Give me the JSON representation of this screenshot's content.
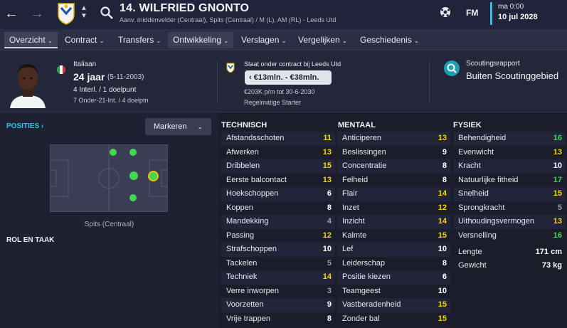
{
  "header": {
    "name": "14. WILFRIED GNONTO",
    "subtitle": "Aanv. middenvelder (Centraal), Spits (Centraal) / M (L), AM (RL) - Leeds Utd",
    "fm_label": "FM",
    "time": "ma 0:00",
    "date": "10 jul 2028"
  },
  "nav": [
    "Overzicht",
    "Contract",
    "Transfers",
    "Ontwikkeling",
    "Verslagen",
    "Vergelijken",
    "Geschiedenis"
  ],
  "info": {
    "nationality": "Italiaan",
    "age": "24 jaar",
    "dob": "(5-11-2003)",
    "caps": "4 Interl. / 1 doelpunt",
    "u21": "7 Onder-21-Int. / 4 doelptn",
    "contract_status": "Staat onder contract bij Leeds Utd",
    "value_range": "€13mln. - €38mln.",
    "wage": "€203K p/m tot 30-6-2030",
    "squad_status": "Regelmatige Starter",
    "scouting_title": "Scoutingsrapport",
    "scouting_value": "Buiten Scoutinggebied"
  },
  "left": {
    "positions_label": "POSITIES",
    "dropdown": "Markeren",
    "position_caption": "Spits (Centraal)",
    "role_label": "ROL EN TAAK"
  },
  "technical": {
    "header": "TECHNISCH",
    "rows": [
      {
        "name": "Afstandsschoten",
        "value": "11",
        "color": "#f5d800"
      },
      {
        "name": "Afwerken",
        "value": "13",
        "color": "#f5d800"
      },
      {
        "name": "Dribbelen",
        "value": "15",
        "color": "#f5d800"
      },
      {
        "name": "Eerste balcontact",
        "value": "13",
        "color": "#f5d800"
      },
      {
        "name": "Hoekschoppen",
        "value": "6",
        "color": "#ffffff"
      },
      {
        "name": "Koppen",
        "value": "8",
        "color": "#ffffff"
      },
      {
        "name": "Mandekking",
        "value": "4",
        "color": "#9a9cab"
      },
      {
        "name": "Passing",
        "value": "12",
        "color": "#f5d800"
      },
      {
        "name": "Strafschoppen",
        "value": "10",
        "color": "#ffffff"
      },
      {
        "name": "Tackelen",
        "value": "5",
        "color": "#9a9cab"
      },
      {
        "name": "Techniek",
        "value": "14",
        "color": "#f5d800"
      },
      {
        "name": "Verre inworpen",
        "value": "3",
        "color": "#9a9cab"
      },
      {
        "name": "Voorzetten",
        "value": "9",
        "color": "#ffffff"
      },
      {
        "name": "Vrije trappen",
        "value": "8",
        "color": "#ffffff"
      }
    ]
  },
  "mental": {
    "header": "MENTAAL",
    "rows": [
      {
        "name": "Anticiperen",
        "value": "13",
        "color": "#f5d800"
      },
      {
        "name": "Beslissingen",
        "value": "9",
        "color": "#ffffff"
      },
      {
        "name": "Concentratie",
        "value": "8",
        "color": "#ffffff"
      },
      {
        "name": "Felheid",
        "value": "8",
        "color": "#ffffff"
      },
      {
        "name": "Flair",
        "value": "14",
        "color": "#f5d800"
      },
      {
        "name": "Inzet",
        "value": "12",
        "color": "#f5d800"
      },
      {
        "name": "Inzicht",
        "value": "14",
        "color": "#f5d800"
      },
      {
        "name": "Kalmte",
        "value": "15",
        "color": "#f5d800"
      },
      {
        "name": "Lef",
        "value": "10",
        "color": "#ffffff"
      },
      {
        "name": "Leiderschap",
        "value": "8",
        "color": "#ffffff"
      },
      {
        "name": "Positie kiezen",
        "value": "6",
        "color": "#ffffff"
      },
      {
        "name": "Teamgeest",
        "value": "10",
        "color": "#ffffff"
      },
      {
        "name": "Vastberadenheid",
        "value": "15",
        "color": "#f5d800"
      },
      {
        "name": "Zonder bal",
        "value": "15",
        "color": "#f5d800"
      }
    ]
  },
  "physical": {
    "header": "FYSIEK",
    "rows": [
      {
        "name": "Behendigheid",
        "value": "16",
        "color": "#3fd850"
      },
      {
        "name": "Evenwicht",
        "value": "13",
        "color": "#f5d800"
      },
      {
        "name": "Kracht",
        "value": "10",
        "color": "#ffffff"
      },
      {
        "name": "Natuurlijke fitheid",
        "value": "17",
        "color": "#3fd850"
      },
      {
        "name": "Snelheid",
        "value": "15",
        "color": "#f5d800"
      },
      {
        "name": "Sprongkracht",
        "value": "5",
        "color": "#9a9cab"
      },
      {
        "name": "Uithoudingsvermogen",
        "value": "13",
        "color": "#f5d800"
      },
      {
        "name": "Versnelling",
        "value": "16",
        "color": "#3fd850"
      }
    ],
    "height_label": "Lengte",
    "height_value": "171 cm",
    "weight_label": "Gewicht",
    "weight_value": "73 kg"
  }
}
